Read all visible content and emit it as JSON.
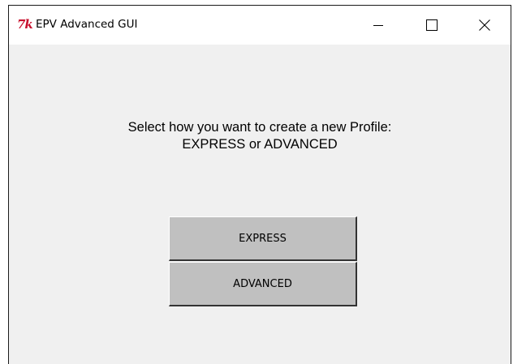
{
  "window": {
    "title": "EPV Advanced GUI",
    "app_icon": "tk-feather-icon",
    "controls": {
      "minimize_icon": "minimize-icon",
      "maximize_icon": "maximize-icon",
      "close_icon": "close-icon"
    }
  },
  "main": {
    "prompt_line1": "Select how you want to create a new Profile:",
    "prompt_line2": "EXPRESS or ADVANCED",
    "express_label": "EXPRESS",
    "advanced_label": "ADVANCED"
  },
  "colors": {
    "app_icon": "#c8102e",
    "window_bg": "#f0f0f0",
    "button_bg": "#c0c0c0"
  }
}
